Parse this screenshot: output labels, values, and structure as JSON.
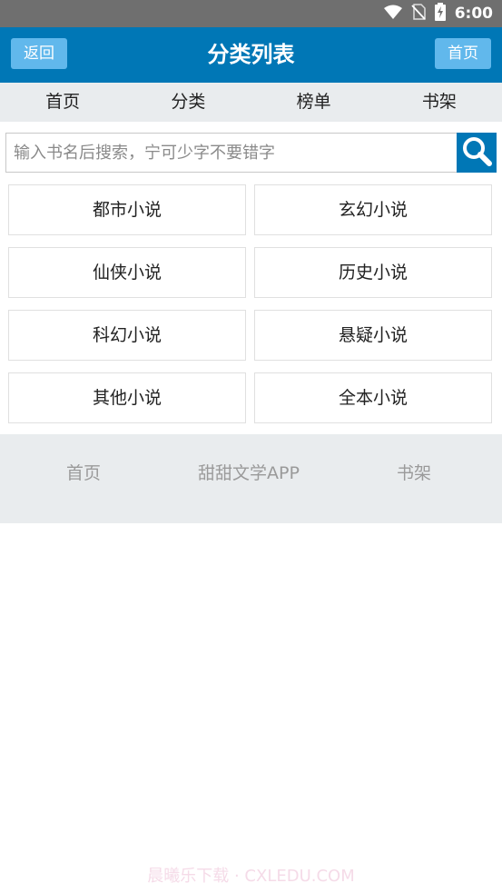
{
  "status_bar": {
    "time": "6:00",
    "icons": [
      "wifi-icon",
      "no-sim-icon",
      "battery-charging-icon"
    ]
  },
  "header": {
    "title": "分类列表",
    "back_label": "返回",
    "home_label": "首页",
    "color": "#0077b6",
    "button_color": "#61b8ec"
  },
  "nav_tabs": [
    {
      "label": "首页"
    },
    {
      "label": "分类"
    },
    {
      "label": "榜单"
    },
    {
      "label": "书架"
    }
  ],
  "search": {
    "placeholder": "输入书名后搜索，宁可少字不要错字",
    "value": "",
    "icon": "search-icon"
  },
  "categories": [
    {
      "label": "都市小说"
    },
    {
      "label": "玄幻小说"
    },
    {
      "label": "仙侠小说"
    },
    {
      "label": "历史小说"
    },
    {
      "label": "科幻小说"
    },
    {
      "label": "悬疑小说"
    },
    {
      "label": "其他小说"
    },
    {
      "label": "全本小说"
    }
  ],
  "footer": {
    "home_label": "首页",
    "app_label": "甜甜文学APP",
    "shelf_label": "书架"
  },
  "watermark": "晨曦乐下载 · CXLEDU.COM"
}
